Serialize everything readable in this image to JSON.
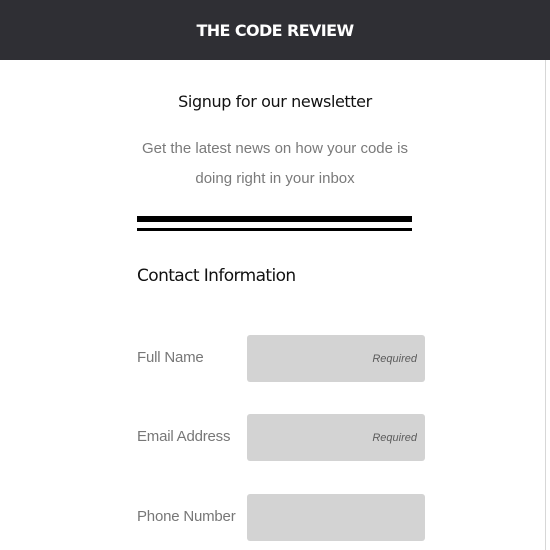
{
  "header": {
    "brand": "THE CODE REVIEW",
    "background_color": "#2f2f34"
  },
  "intro": {
    "title": "Signup for our newsletter",
    "subtitle": "Get the latest news on how your code is doing right in your inbox"
  },
  "form": {
    "section_title": "Contact Information",
    "fields": [
      {
        "label": "Full Name",
        "placeholder": "Required",
        "value": ""
      },
      {
        "label": "Email Address",
        "placeholder": "Required",
        "value": ""
      },
      {
        "label": "Phone Number",
        "placeholder": "",
        "value": ""
      }
    ]
  },
  "colors": {
    "input_background": "#d3d3d3",
    "label_text": "#777777",
    "divider": "#000000"
  }
}
